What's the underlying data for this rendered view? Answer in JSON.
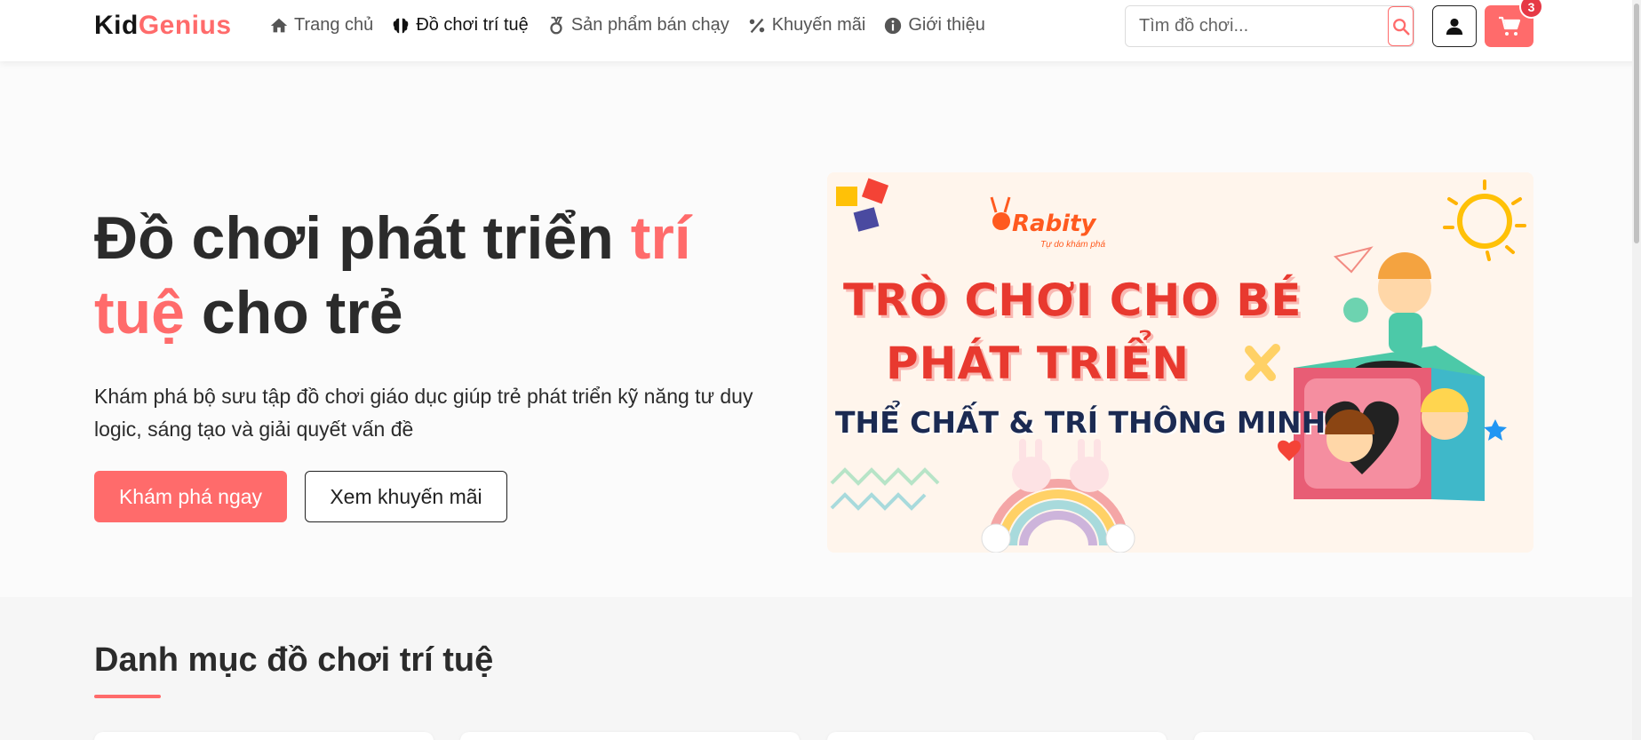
{
  "brand": {
    "part1": "Kid",
    "part2": "Genius"
  },
  "nav": [
    {
      "label": "Trang chủ",
      "icon": "home-icon"
    },
    {
      "label": "Đồ chơi trí tuệ",
      "icon": "brain-icon"
    },
    {
      "label": "Sản phẩm bán chạy",
      "icon": "medal-icon"
    },
    {
      "label": "Khuyến mãi",
      "icon": "percent-icon"
    },
    {
      "label": "Giới thiệu",
      "icon": "info-icon"
    }
  ],
  "search": {
    "placeholder": "Tìm đồ chơi..."
  },
  "cart": {
    "count": "3"
  },
  "hero": {
    "title_part1": "Đồ chơi phát triển ",
    "title_highlight": "trí tuệ",
    "title_part2": " cho trẻ",
    "description": "Khám phá bộ sưu tập đồ chơi giáo dục giúp trẻ phát triển kỹ năng tư duy logic, sáng tạo và giải quyết vấn đề",
    "primary_button": "Khám phá ngay",
    "secondary_button": "Xem khuyến mãi"
  },
  "banner": {
    "brand": "Rabity",
    "tagline": "Tự do khám phá",
    "line1": "TRÒ CHƠI CHO BÉ",
    "line2": "PHÁT TRIỂN",
    "line3": "THỂ CHẤT & TRÍ THÔNG MINH"
  },
  "categories": {
    "title": "Danh mục đồ chơi trí tuệ"
  },
  "colors": {
    "accent": "#ff6b6b",
    "badge": "#e63946",
    "dark": "#2b2b2b"
  }
}
